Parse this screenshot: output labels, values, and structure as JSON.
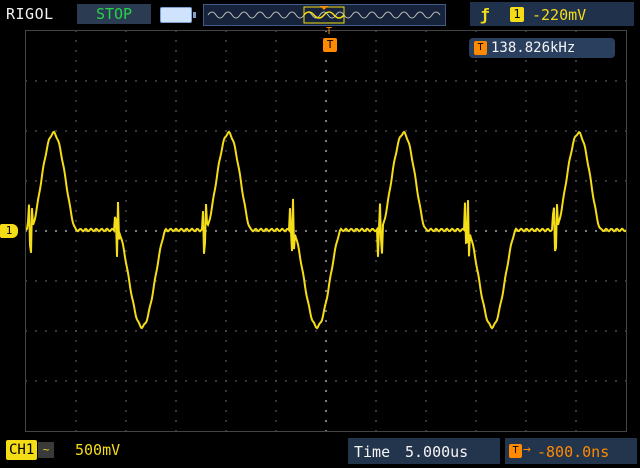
{
  "header": {
    "brand": "RIGOL",
    "run_status": "STOP",
    "trigger_edge_icon": "rising-edge-icon",
    "trigger_channel": "1",
    "trigger_level": "-220mV"
  },
  "screen": {
    "trigger_position_letter": "T",
    "trigger_badge": "T",
    "frequency_badge": "T",
    "frequency": "138.826kHz",
    "channel_marker": "1"
  },
  "footer": {
    "channel_label": "CH1",
    "coupling_symbol": "~",
    "volts_per_div": "500mV",
    "time_label": "Time",
    "time_per_div": "5.000us",
    "offset_badge": "T",
    "offset_arrow": "→",
    "trigger_offset": "-800.0ns"
  },
  "colors": {
    "trace": "#f4dc17",
    "trigger": "#ff8a00",
    "status": "#25d34b",
    "grid": "#8a8a8a",
    "panel": "#23344d"
  }
}
